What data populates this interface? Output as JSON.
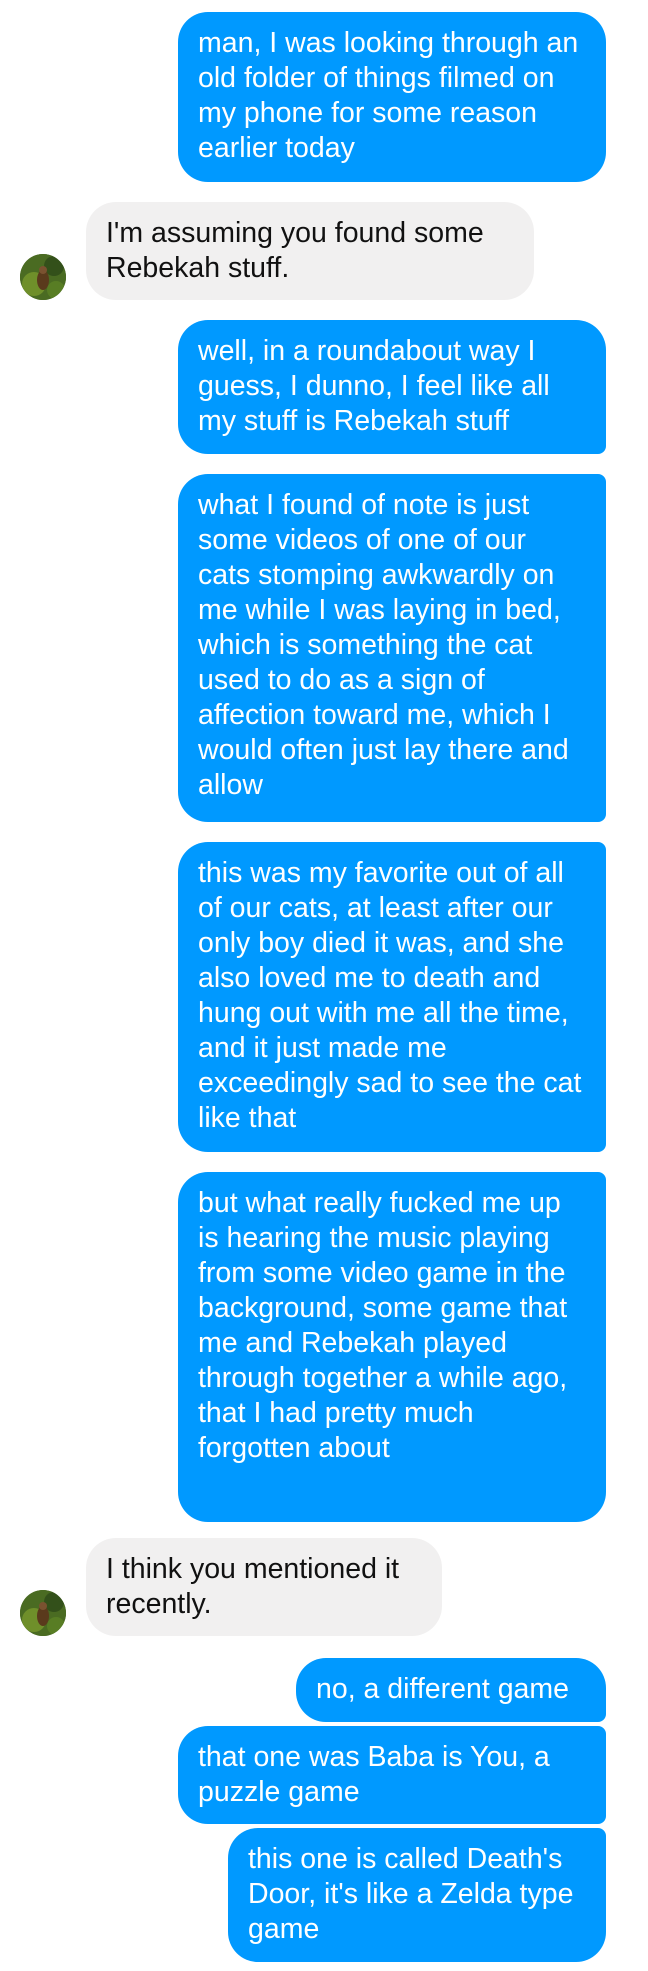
{
  "colors": {
    "outgoing_bubble": "#0099ff",
    "incoming_bubble": "#f1f0f0",
    "outgoing_text": "#ffffff",
    "incoming_text": "#111111"
  },
  "messages": [
    {
      "from": "me",
      "text": "man, I was looking through an old folder of things filmed on my phone for some reason earlier today"
    },
    {
      "from": "them",
      "text": "I'm assuming you found some Rebekah stuff."
    },
    {
      "from": "me",
      "text": "well, in a roundabout way I guess, I dunno, I feel like all my stuff is Rebekah stuff"
    },
    {
      "from": "me",
      "text": "what I found of note is just some videos of one of our cats stomping awkwardly on me while I was laying in bed, which is something the cat used to do as a sign of affection toward me, which I would often just lay there and allow"
    },
    {
      "from": "me",
      "text": "this was my favorite out of all of our cats, at least after our only boy died it was, and she also loved me to death and hung out with me all the time, and it just made me exceedingly sad to see the cat like that"
    },
    {
      "from": "me",
      "text": "but what really fucked me up is hearing the music playing from some video game in the background, some game that me and Rebekah played through together a while ago, that I had pretty much forgotten about"
    },
    {
      "from": "them",
      "text": "I think you mentioned it recently."
    },
    {
      "from": "me",
      "text": "no, a different game"
    },
    {
      "from": "me",
      "text": "that one was Baba is You, a puzzle game"
    },
    {
      "from": "me",
      "text": "this one is called Death's Door, it's like a Zelda type game"
    }
  ],
  "avatar": {
    "icon": "contact-avatar-icon"
  }
}
